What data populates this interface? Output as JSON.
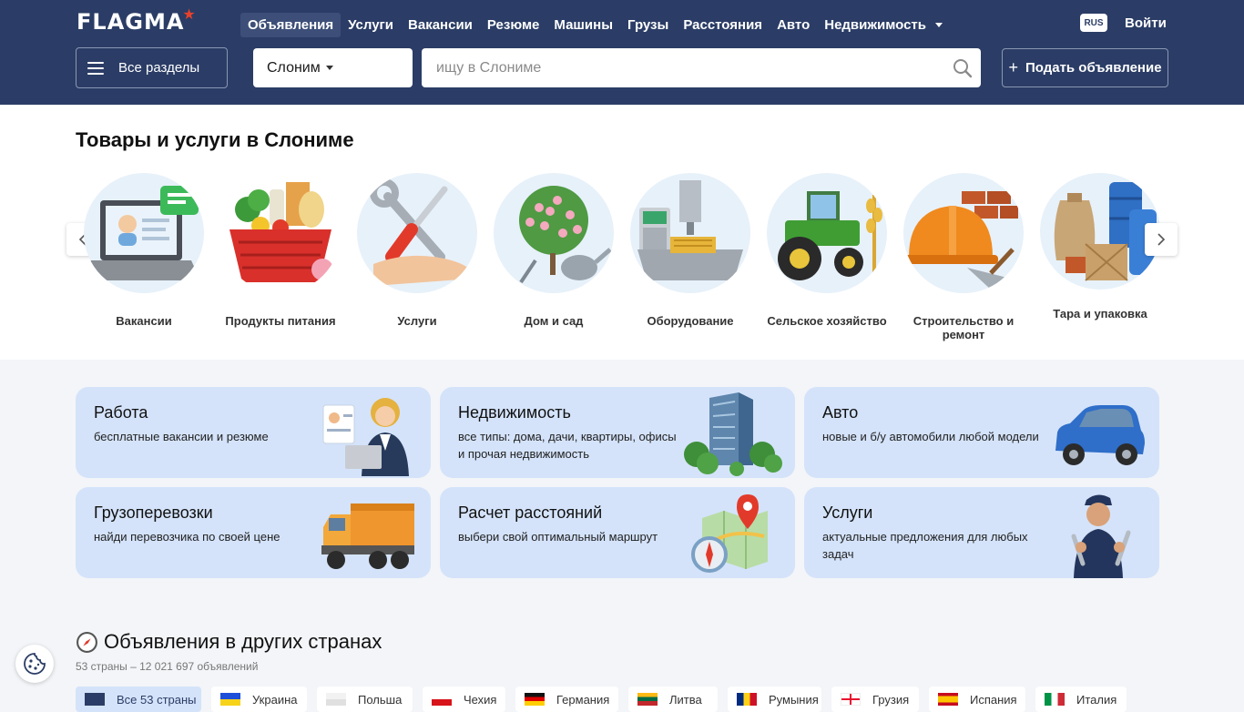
{
  "header": {
    "logo_text": "FLAGMA",
    "nav": [
      {
        "label": "Объявления",
        "active": true
      },
      {
        "label": "Услуги"
      },
      {
        "label": "Вакансии"
      },
      {
        "label": "Резюме"
      },
      {
        "label": "Машины"
      },
      {
        "label": "Грузы"
      },
      {
        "label": "Расстояния"
      },
      {
        "label": "Авто"
      },
      {
        "label": "Недвижимость"
      }
    ],
    "lang": "RUS",
    "login": "Войти",
    "all_sections": "Все разделы",
    "city": "Слоним",
    "search_placeholder": "ищу в Слониме",
    "post_ad": "Подать объявление"
  },
  "categories": {
    "title": "Товары и услуги в Слониме",
    "items": [
      {
        "label": "Вакансии",
        "icon": "laptop-resume-icon"
      },
      {
        "label": "Продукты питания",
        "icon": "grocery-basket-icon"
      },
      {
        "label": "Услуги",
        "icon": "tools-hand-icon"
      },
      {
        "label": "Дом и сад",
        "icon": "garden-icon"
      },
      {
        "label": "Оборудование",
        "icon": "cnc-machine-icon"
      },
      {
        "label": "Сельское хозяйство",
        "icon": "tractor-icon"
      },
      {
        "label": "Строительство и ремонт",
        "icon": "helmet-bricks-icon"
      },
      {
        "label": "Тара и упаковка",
        "icon": "packaging-icon"
      }
    ]
  },
  "promos": [
    {
      "title": "Работа",
      "desc": "бесплатные вакансии и резюме",
      "icon": "businesswoman-icon"
    },
    {
      "title": "Недвижимость",
      "desc": "все типы: дома, дачи, квартиры, офисы и прочая недвижимость",
      "icon": "building-icon"
    },
    {
      "title": "Авто",
      "desc": "новые и б/у автомобили любой модели",
      "icon": "car-icon"
    },
    {
      "title": "Грузоперевозки",
      "desc": "найди перевозчика по своей цене",
      "icon": "truck-icon"
    },
    {
      "title": "Расчет расстояний",
      "desc": "выбери свой оптимальный маршрут",
      "icon": "map-compass-icon"
    },
    {
      "title": "Услуги",
      "desc": "актуальные предложения для любых задач",
      "icon": "mechanic-icon"
    }
  ],
  "countries": {
    "title": "Объявления в других странах",
    "subtitle": "53 страны – 12 021 697 объявлений",
    "chips": [
      {
        "label": "Все 53 страны",
        "active": true
      },
      {
        "label": "Украина"
      },
      {
        "label": "Польша"
      },
      {
        "label": "Чехия"
      },
      {
        "label": "Германия"
      },
      {
        "label": "Литва"
      },
      {
        "label": "Румыния"
      },
      {
        "label": "Грузия"
      },
      {
        "label": "Испания"
      },
      {
        "label": "Италия"
      }
    ]
  },
  "colors": {
    "header_bg": "#2b3d66",
    "promo_bg": "#d4e3fa",
    "accent_red": "#e8412b"
  }
}
